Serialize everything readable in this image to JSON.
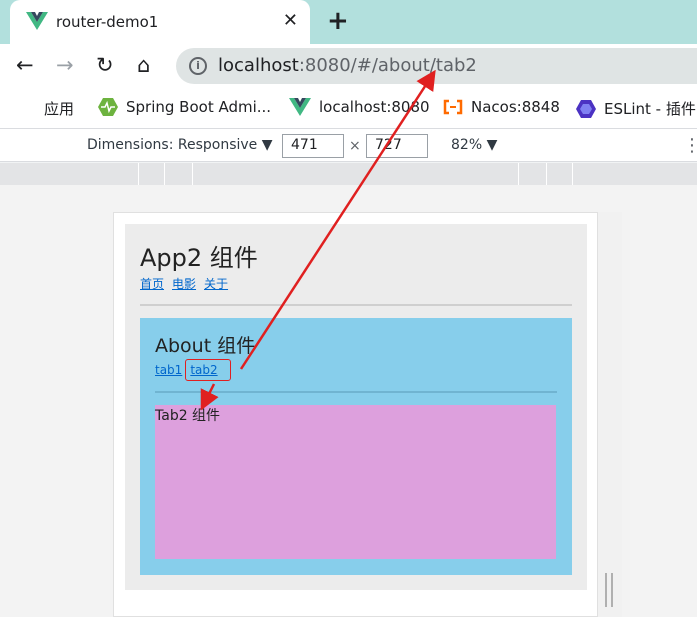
{
  "browser": {
    "tab_title": "router-demo1",
    "close_glyph": "✕",
    "new_tab_glyph": "+",
    "url_host": "localhost",
    "url_rest": ":8080/#/about/tab2",
    "info_glyph": "i"
  },
  "nav": {
    "back_glyph": "←",
    "forward_glyph": "→",
    "reload_glyph": "↻",
    "home_glyph": "⌂"
  },
  "bookmarks": [
    {
      "label": "应用",
      "icon": "apps-grid-icon"
    },
    {
      "label": "Spring Boot Admi...",
      "icon": "heartbeat-icon"
    },
    {
      "label": "localhost:8080",
      "icon": "vue-icon"
    },
    {
      "label": "Nacos:8848",
      "icon": "alibaba-cloud-icon"
    },
    {
      "label": "ESLint - 插件",
      "icon": "eslint-icon"
    }
  ],
  "devtools": {
    "dimensions_label": "Dimensions: Responsive ▼",
    "width": "471",
    "times": "×",
    "height": "727",
    "zoom": "82% ▼",
    "more_glyph": "⋮"
  },
  "app2": {
    "title": "App2 组件",
    "nav": [
      "首页",
      "电影",
      "关于"
    ]
  },
  "about": {
    "title": "About 组件",
    "nav": [
      "tab1",
      "tab2"
    ]
  },
  "tab2": {
    "text": "Tab2 组件"
  },
  "colors": {
    "tab_strip": "#b2e0dd",
    "app2_bg": "#ececec",
    "about_bg": "#87ceeb",
    "tab2_bg": "#dda0dd",
    "annotation": "#e02020",
    "link": "#0066cc"
  }
}
